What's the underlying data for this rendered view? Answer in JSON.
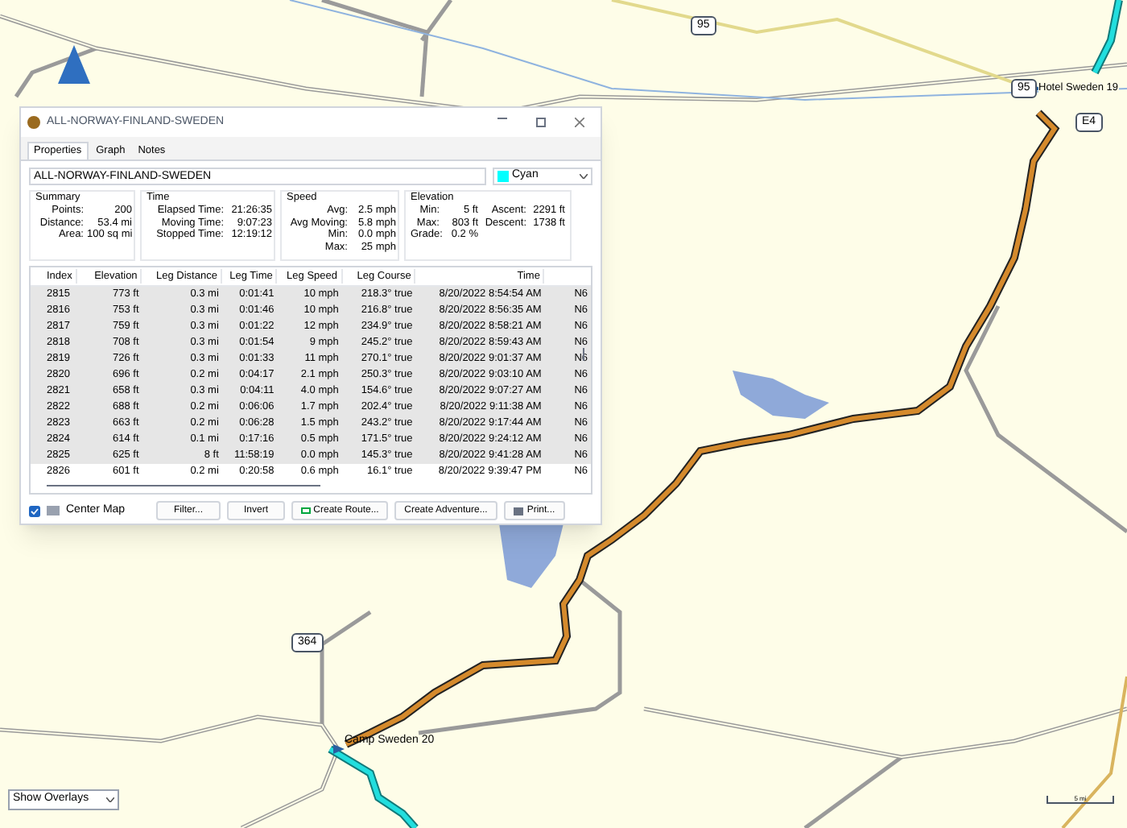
{
  "map": {
    "road_shields": [
      {
        "label": "95",
        "kind": "route"
      },
      {
        "label": "95",
        "kind": "route"
      },
      {
        "label": "E4",
        "kind": "route"
      },
      {
        "label": "364",
        "kind": "route"
      }
    ],
    "places": [
      "Hotel Sweden 19",
      "Camp Sweden 20"
    ],
    "scale_label": "5 mi",
    "overlay_select": {
      "value": "Show Overlays"
    }
  },
  "window": {
    "title": "ALL-NORWAY-FINLAND-SWEDEN",
    "tabs": [
      {
        "label": "Properties",
        "selected": true
      },
      {
        "label": "Graph",
        "selected": false
      },
      {
        "label": "Notes",
        "selected": false
      }
    ],
    "name_field": {
      "value": "ALL-NORWAY-FINLAND-SWEDEN"
    },
    "color_select": {
      "value": "Cyan",
      "color": "#00ffff"
    },
    "groups": [
      {
        "title": "Summary",
        "rows": [
          [
            "Points:",
            "200"
          ],
          [
            "Distance:",
            "53.4 mi"
          ],
          [
            "Area:",
            "100 sq mi"
          ]
        ]
      },
      {
        "title": "Time",
        "rows": [
          [
            "Elapsed Time:",
            "21:26:35"
          ],
          [
            "Moving Time:",
            "9:07:23"
          ],
          [
            "Stopped Time:",
            "12:19:12"
          ]
        ]
      },
      {
        "title": "Speed",
        "rows": [
          [
            "Avg:",
            "2.5 mph"
          ],
          [
            "Avg Moving:",
            "5.8 mph"
          ],
          [
            "Min:",
            "0.0 mph"
          ],
          [
            "Max:",
            "25 mph"
          ]
        ]
      },
      {
        "title": "Elevation",
        "rows": [
          [
            "Min:",
            "5 ft",
            "Ascent:",
            "2291 ft"
          ],
          [
            "Max:",
            "803 ft",
            "Descent:",
            "1738 ft"
          ],
          [
            "Grade:",
            "0.2 %"
          ]
        ]
      }
    ],
    "table": {
      "columns": [
        "Index",
        "Elevation",
        "Leg Distance",
        "Leg Time",
        "Leg Speed",
        "Leg Course",
        "Time",
        ""
      ],
      "rows": [
        {
          "cells": [
            "2815",
            "773 ft",
            "0.3 mi",
            "0:01:41",
            "10 mph",
            "218.3° true",
            "8/20/2022 8:54:54 AM",
            "N6"
          ],
          "selected": true
        },
        {
          "cells": [
            "2816",
            "753 ft",
            "0.3 mi",
            "0:01:46",
            "10 mph",
            "216.8° true",
            "8/20/2022 8:56:35 AM",
            "N6"
          ],
          "selected": true
        },
        {
          "cells": [
            "2817",
            "759 ft",
            "0.3 mi",
            "0:01:22",
            "12 mph",
            "234.9° true",
            "8/20/2022 8:58:21 AM",
            "N6"
          ],
          "selected": true
        },
        {
          "cells": [
            "2818",
            "708 ft",
            "0.3 mi",
            "0:01:54",
            "9 mph",
            "245.2° true",
            "8/20/2022 8:59:43 AM",
            "N6"
          ],
          "selected": true
        },
        {
          "cells": [
            "2819",
            "726 ft",
            "0.3 mi",
            "0:01:33",
            "11 mph",
            "270.1° true",
            "8/20/2022 9:01:37 AM",
            "N6"
          ],
          "selected": true
        },
        {
          "cells": [
            "2820",
            "696 ft",
            "0.2 mi",
            "0:04:17",
            "2.1 mph",
            "250.3° true",
            "8/20/2022 9:03:10 AM",
            "N6"
          ],
          "selected": true
        },
        {
          "cells": [
            "2821",
            "658 ft",
            "0.3 mi",
            "0:04:11",
            "4.0 mph",
            "154.6° true",
            "8/20/2022 9:07:27 AM",
            "N6"
          ],
          "selected": true
        },
        {
          "cells": [
            "2822",
            "688 ft",
            "0.2 mi",
            "0:06:06",
            "1.7 mph",
            "202.4° true",
            "8/20/2022 9:11:38 AM",
            "N6"
          ],
          "selected": true
        },
        {
          "cells": [
            "2823",
            "663 ft",
            "0.2 mi",
            "0:06:28",
            "1.5 mph",
            "243.2° true",
            "8/20/2022 9:17:44 AM",
            "N6"
          ],
          "selected": true
        },
        {
          "cells": [
            "2824",
            "614 ft",
            "0.1 mi",
            "0:17:16",
            "0.5 mph",
            "171.5° true",
            "8/20/2022 9:24:12 AM",
            "N6"
          ],
          "selected": true
        },
        {
          "cells": [
            "2825",
            "625 ft",
            "8 ft",
            "11:58:19",
            "0.0 mph",
            "145.3° true",
            "8/20/2022 9:41:28 AM",
            "N6"
          ],
          "selected": true
        },
        {
          "cells": [
            "2826",
            "601 ft",
            "0.2 mi",
            "0:20:58",
            "0.6 mph",
            "16.1° true",
            "8/20/2022 9:39:47 PM",
            "N6"
          ],
          "selected": false
        }
      ]
    },
    "center_map": {
      "label": "Center Map",
      "checked": true
    },
    "buttons": [
      {
        "label": "Filter...",
        "kind": "plain"
      },
      {
        "label": "Invert",
        "kind": "plain"
      },
      {
        "label": "Create Route...",
        "kind": "route"
      },
      {
        "label": "Create Adventure...",
        "kind": "plain"
      },
      {
        "label": "Print...",
        "kind": "print"
      }
    ]
  }
}
